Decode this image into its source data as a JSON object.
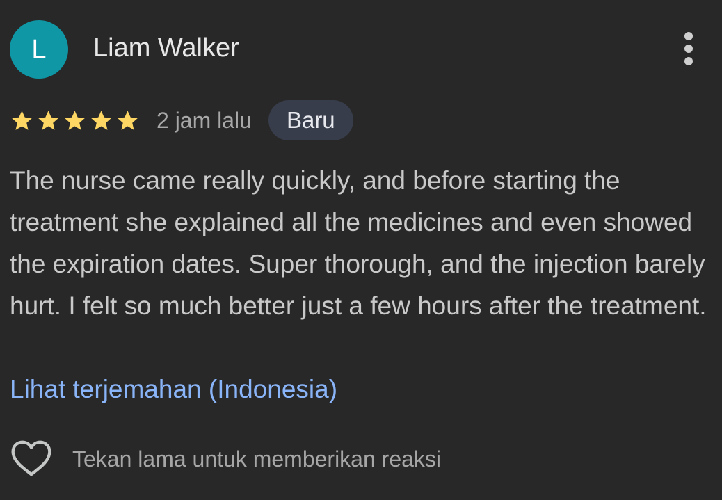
{
  "review": {
    "avatar_letter": "L",
    "reviewer_name": "Liam Walker",
    "rating": 5,
    "rating_max": 5,
    "time_ago": "2 jam lalu",
    "badge": "Baru",
    "text": "The nurse came really quickly, and before starting the treatment she explained all the medicines and even showed the expiration dates. Super thorough, and the injection barely hurt. I felt so much better just a few hours after the treatment.",
    "translate_link": "Lihat terjemahan (Indonesia)",
    "reaction_hint": "Tekan lama untuk memberikan reaksi"
  },
  "icons": {
    "more": "more-vert-icon",
    "star": "star-icon",
    "heart": "heart-outline-icon"
  },
  "colors": {
    "background": "#282828",
    "avatar": "#0f97a6",
    "star": "#fdd663",
    "badge_bg": "#383d4b",
    "link": "#8ab4f8"
  }
}
